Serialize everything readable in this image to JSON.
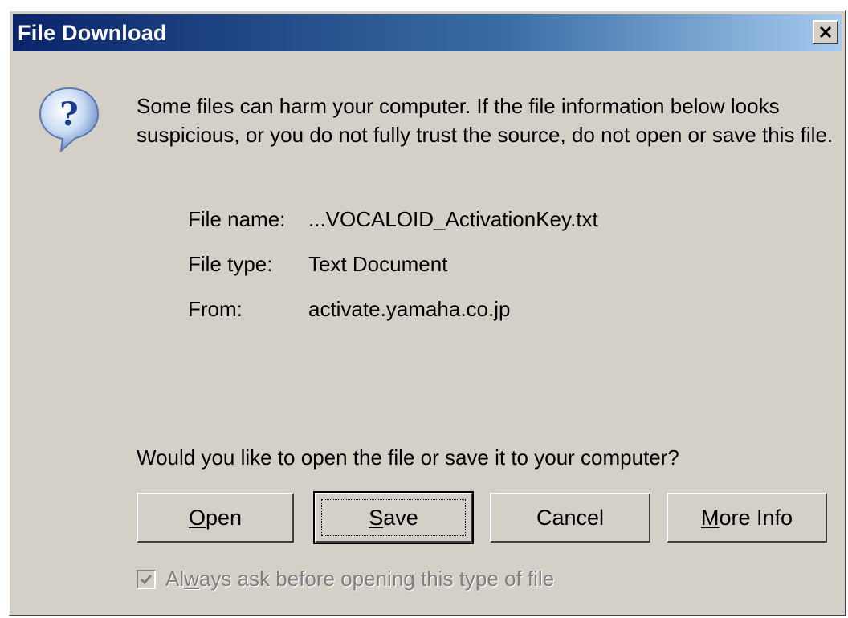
{
  "window": {
    "title": "File Download",
    "close_symbol": "✕"
  },
  "message": {
    "icon": "question-icon",
    "warning": "Some files can harm your computer. If the file information below looks suspicious, or you do not fully trust the source, do not open or save this file."
  },
  "file_info": {
    "name_label": "File name:",
    "name_value": "...VOCALOID_ActivationKey.txt",
    "type_label": "File type:",
    "type_value": "Text Document",
    "from_label": "From:",
    "from_value": "activate.yamaha.co.jp"
  },
  "prompt": "Would you like to open the file or save it to your computer?",
  "buttons": {
    "open": {
      "mnemonic": "O",
      "rest": "pen"
    },
    "save": {
      "mnemonic": "S",
      "rest": "ave"
    },
    "cancel": "Cancel",
    "more_info": {
      "mnemonic": "M",
      "rest": "ore Info"
    }
  },
  "checkbox": {
    "checked": true,
    "prefix": "Al",
    "mnemonic": "w",
    "suffix": "ays ask before opening this type of file"
  },
  "colors": {
    "title_gradient_start": "#0a246a",
    "title_gradient_end": "#a6caf0",
    "dialog_face": "#d4d0c8",
    "disabled_text": "#808080"
  }
}
